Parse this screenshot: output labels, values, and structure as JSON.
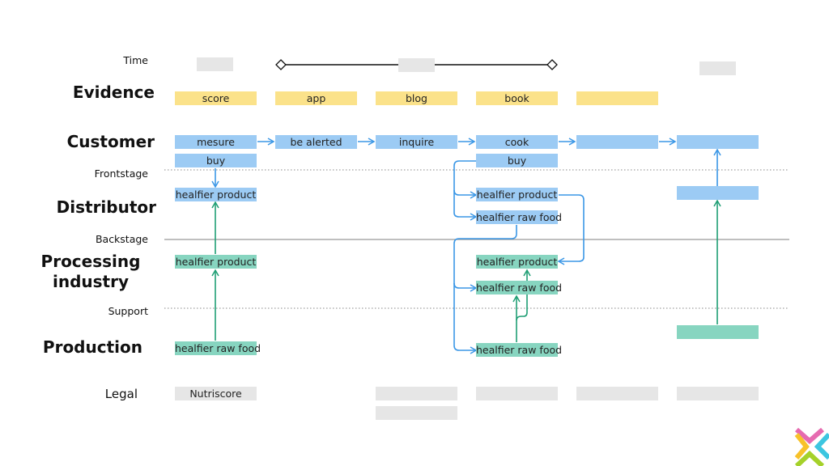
{
  "lanes": {
    "time": "Time",
    "evidence": "Evidence",
    "customer": "Customer",
    "frontstage": "Frontstage",
    "distributor": "Distributor",
    "backstage": "Backstage",
    "processing": "Processing industry",
    "support": "Support",
    "production": "Production",
    "legal": "Legal"
  },
  "evidence": [
    "score",
    "app",
    "blog",
    "book",
    ""
  ],
  "customer": [
    "mesure",
    "be alerted",
    "inquire",
    "cook",
    "",
    ""
  ],
  "customer_sub": [
    "buy",
    "buy"
  ],
  "distributor": [
    "healfier product",
    "healfier product",
    "healfier raw food",
    ""
  ],
  "processing": [
    "healfier product",
    "healfier product",
    "healfier raw food"
  ],
  "production": [
    "healfier raw food",
    "healfier raw food",
    ""
  ],
  "legal": [
    "Nutriscore",
    "",
    "",
    "",
    ""
  ],
  "colors": {
    "evidence": "#fbe28a",
    "frontstage": "#9ccbf4",
    "backstage": "#87d5c0",
    "legal": "#e6e6e6",
    "arrow_blue": "#3b97e6",
    "arrow_green": "#1f9e74"
  }
}
